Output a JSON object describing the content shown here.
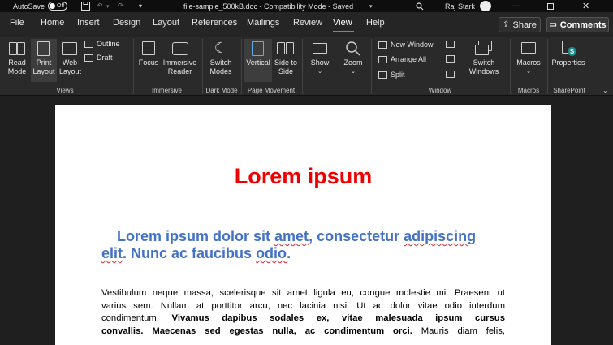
{
  "titlebar": {
    "autosave_label": "AutoSave",
    "autosave_state": "Off",
    "doc_title": "file-sample_500kB.doc  -  Compatibility Mode  -  Saved",
    "user_name": "Raj Stark"
  },
  "menu": {
    "tabs": [
      "File",
      "Home",
      "Insert",
      "Design",
      "Layout",
      "References",
      "Mailings",
      "Review",
      "View",
      "Help"
    ],
    "active_tab": "View",
    "share_label": "Share",
    "comments_label": "Comments"
  },
  "ribbon": {
    "read_mode": "Read Mode",
    "print_layout": "Print Layout",
    "web_layout": "Web Layout",
    "outline": "Outline",
    "draft": "Draft",
    "views_group": "Views",
    "focus": "Focus",
    "immersive_reader": "Immersive Reader",
    "immersive_group": "Immersive",
    "switch_modes": "Switch Modes",
    "dark_mode_group": "Dark Mode",
    "vertical": "Vertical",
    "side_to_side": "Side to Side",
    "page_movement_group": "Page Movement",
    "show": "Show",
    "zoom": "Zoom",
    "new_window": "New Window",
    "arrange_all": "Arrange All",
    "split": "Split",
    "switch_windows": "Switch Windows",
    "window_group": "Window",
    "macros": "Macros",
    "macros_group": "Macros",
    "properties": "Properties",
    "sharepoint_group": "SharePoint"
  },
  "document": {
    "title": "Lorem ipsum",
    "subtitle_parts": [
      "Lorem ipsum dolor sit ",
      "amet",
      ", consectetur ",
      "adipiscing",
      " ",
      "elit",
      ". Nunc ac faucibus ",
      "odio",
      "."
    ],
    "paragraph_line1": "Vestibulum neque massa, scelerisque sit amet ligula eu, congue molestie mi. Praesent ut",
    "paragraph_line2": "varius sem. Nullam at porttitor arcu, nec lacinia nisi. Ut ac dolor vitae odio interdum",
    "paragraph_line3_plain": "condimentum. ",
    "paragraph_line3_bold": "Vivamus dapibus sodales ex, vitae malesuada ipsum cursus",
    "paragraph_line4_bold": "convallis. Maecenas sed egestas nulla, ac condimentum orci.",
    "paragraph_line4_plain": " Mauris diam felis,"
  },
  "colors": {
    "title_red": "#ee0000",
    "heading_blue": "#4472c4",
    "accent_blue": "#4f8fe0"
  }
}
